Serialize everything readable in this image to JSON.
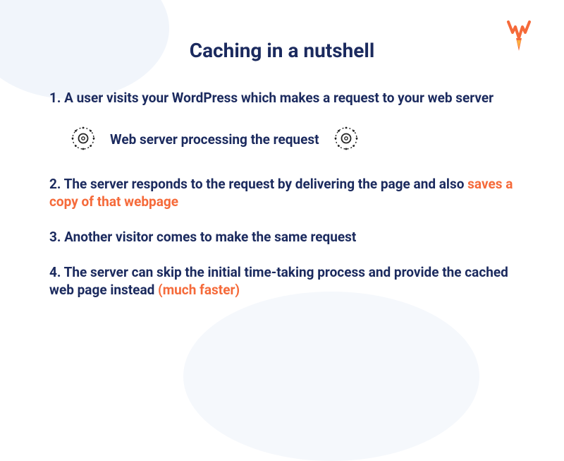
{
  "title": "Caching in a nutshell",
  "steps": {
    "s1": "1. A user visits your WordPress which makes a request to your web server",
    "s2a": "2. The server responds to the request by delivering the page and also ",
    "s2b": "saves a copy of that webpage",
    "s3": "3. Another visitor comes to make the same request",
    "s4a": "4. The server can skip the initial time-taking process and provide the cached web page instead ",
    "s4b": "(much faster)"
  },
  "processing_label": "Web server processing the request",
  "icons": {
    "gear": "gear-icon",
    "logo": "wp-rocket-logo"
  },
  "colors": {
    "primary": "#1b2a5e",
    "accent": "#f56a3a"
  }
}
